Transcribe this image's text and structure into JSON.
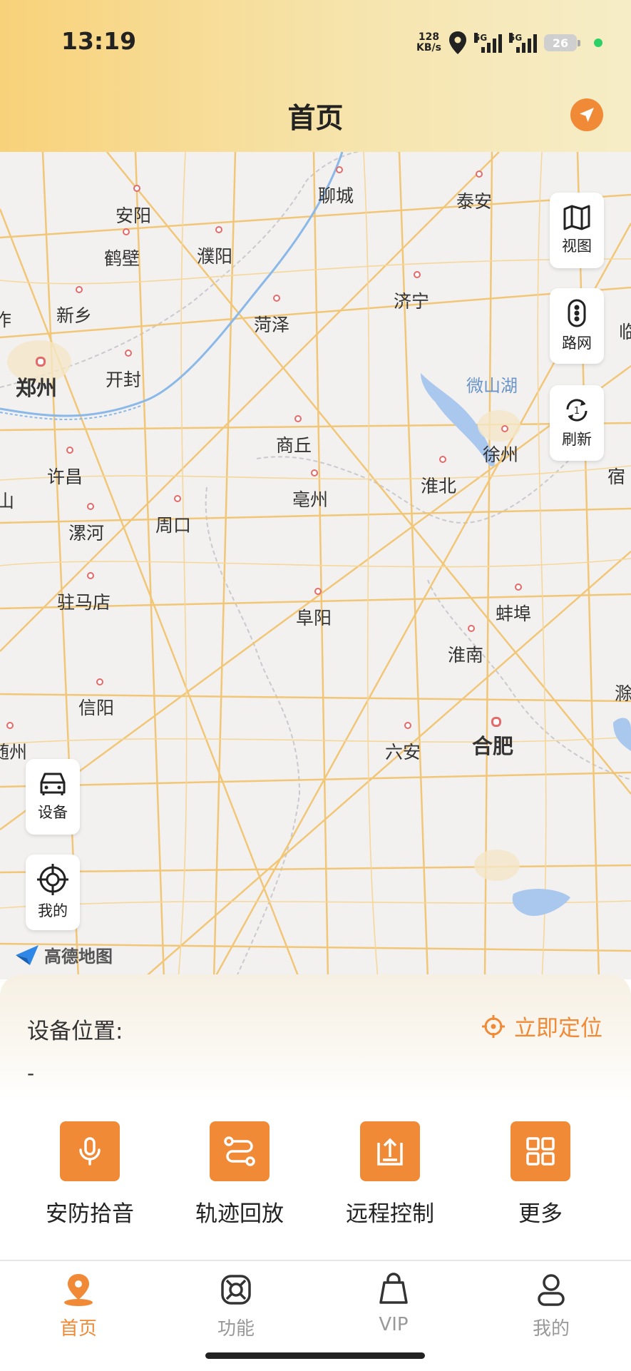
{
  "status_bar": {
    "time": "13:19",
    "speed_value": "128",
    "speed_unit": "KB/s",
    "network1": "5G",
    "network2": "5G",
    "battery": "26"
  },
  "header": {
    "title": "首页",
    "nav_icon": "navigation-arrow-icon"
  },
  "map": {
    "cities": [
      {
        "name": "聊城"
      },
      {
        "name": "泰安"
      },
      {
        "name": "安阳"
      },
      {
        "name": "鹤壁"
      },
      {
        "name": "濮阳"
      },
      {
        "name": "济宁"
      },
      {
        "name": "新乡"
      },
      {
        "name": "菏泽"
      },
      {
        "name": "郑州"
      },
      {
        "name": "开封"
      },
      {
        "name": "微山湖"
      },
      {
        "name": "商丘"
      },
      {
        "name": "徐州"
      },
      {
        "name": "许昌"
      },
      {
        "name": "淮北"
      },
      {
        "name": "亳州"
      },
      {
        "name": "宿"
      },
      {
        "name": "漯河"
      },
      {
        "name": "周口"
      },
      {
        "name": "驻马店"
      },
      {
        "name": "蚌埠"
      },
      {
        "name": "阜阳"
      },
      {
        "name": "淮南"
      },
      {
        "name": "信阳"
      },
      {
        "name": "六安"
      },
      {
        "name": "合肥"
      },
      {
        "name": "随州"
      },
      {
        "name": "临"
      },
      {
        "name": "作"
      },
      {
        "name": "山"
      },
      {
        "name": "滁"
      }
    ],
    "buttons": {
      "view": "视图",
      "traffic": "路网",
      "refresh": "刷新",
      "device": "设备",
      "mine": "我的"
    },
    "provider": "高德地图"
  },
  "location": {
    "label": "设备位置:",
    "value": "-",
    "locate_now": "立即定位"
  },
  "functions": [
    {
      "label": "安防拾音",
      "icon": "microphone-icon"
    },
    {
      "label": "轨迹回放",
      "icon": "route-icon"
    },
    {
      "label": "远程控制",
      "icon": "upload-box-icon"
    },
    {
      "label": "更多",
      "icon": "grid-icon"
    }
  ],
  "tabs": [
    {
      "label": "首页",
      "icon": "home-location-icon"
    },
    {
      "label": "功能",
      "icon": "lifebuoy-icon"
    },
    {
      "label": "VIP",
      "icon": "bag-icon"
    },
    {
      "label": "我的",
      "icon": "user-icon"
    }
  ],
  "colors": {
    "accent": "#f08a37",
    "header_start": "#f8d27a",
    "header_end": "#f6edc7"
  }
}
